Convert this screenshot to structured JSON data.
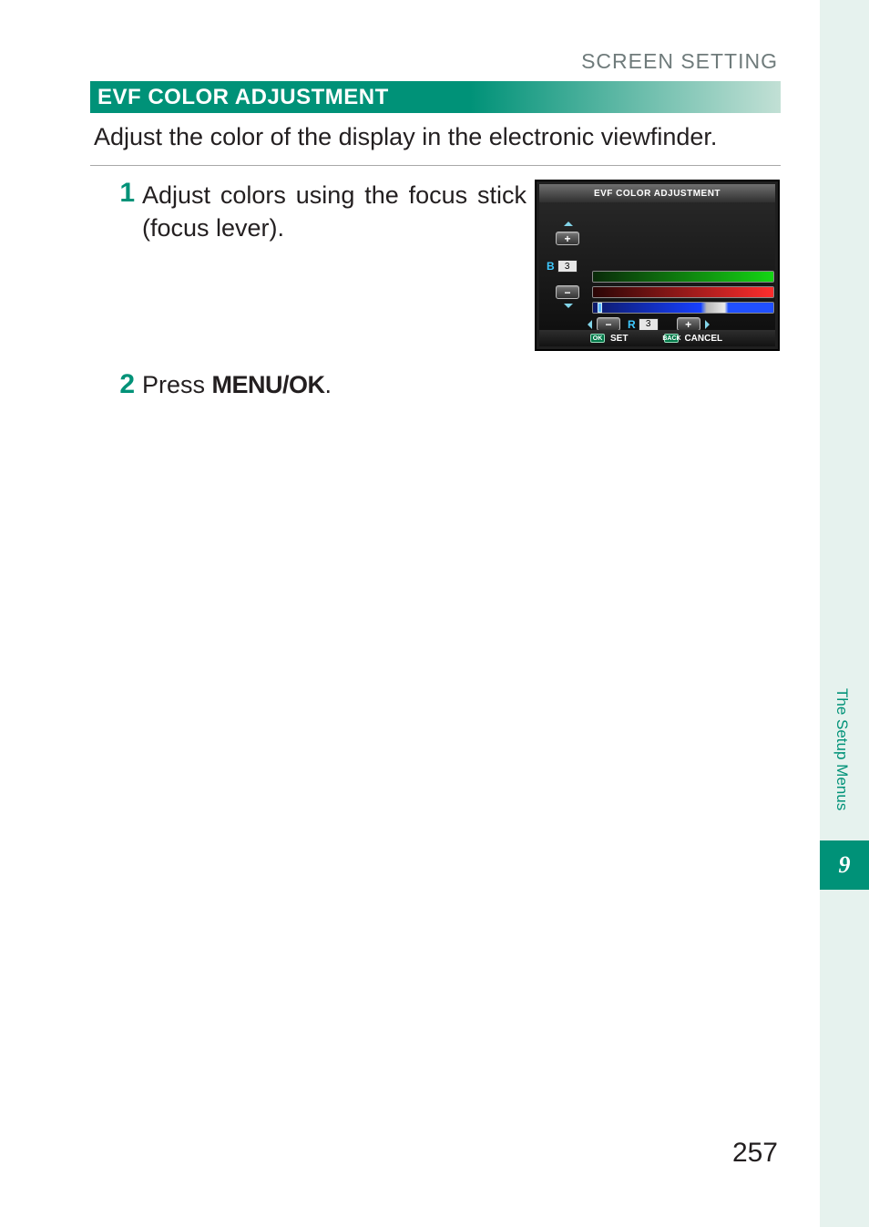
{
  "header": {
    "breadcrumb": "SCREEN SETTING"
  },
  "section": {
    "title": "EVF COLOR ADJUSTMENT",
    "intro": "Adjust the color of the display in the electronic viewfinder."
  },
  "steps": [
    {
      "num": "1",
      "text": "Adjust colors using the focus stick (focus lever)."
    },
    {
      "num": "2",
      "prefix": "Press ",
      "cmd": "MENU/OK",
      "suffix": "."
    }
  ],
  "evf": {
    "title": "EVF COLOR ADJUSTMENT",
    "b_label": "B",
    "b_value": "3",
    "r_label": "R",
    "r_value": "3",
    "plus": "+",
    "minus": "−",
    "footer": {
      "set_icon_text": "OK",
      "set": "SET",
      "cancel_icon_text": "BACK",
      "cancel": "CANCEL"
    }
  },
  "side": {
    "chapter": "The Setup Menus",
    "chapter_num": "9"
  },
  "page": {
    "number": "257"
  }
}
